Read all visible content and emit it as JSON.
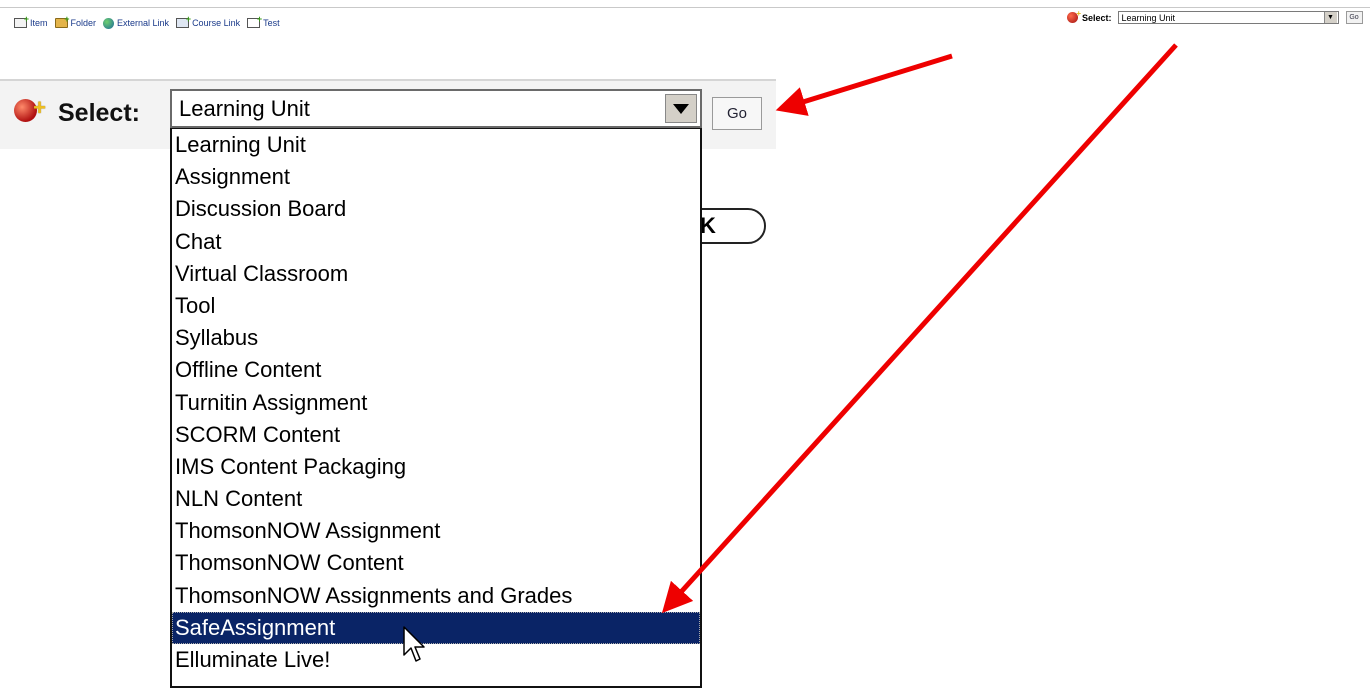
{
  "toolbar": {
    "items": [
      {
        "label": "Item",
        "icon": "add-item-icon"
      },
      {
        "label": "Folder",
        "icon": "add-folder-icon"
      },
      {
        "label": "External Link",
        "icon": "globe-icon"
      },
      {
        "label": "Course Link",
        "icon": "add-course-link-icon"
      },
      {
        "label": "Test",
        "icon": "add-test-icon"
      }
    ]
  },
  "small_select": {
    "label": "Select:",
    "value": "Learning Unit",
    "go_label": "Go"
  },
  "big_select": {
    "label": "Select:",
    "value": "Learning Unit",
    "go_label": "Go",
    "options": [
      "Learning Unit",
      "Assignment",
      "Discussion Board",
      "Chat",
      "Virtual Classroom",
      "Tool",
      "Syllabus",
      "Offline Content",
      "Turnitin Assignment",
      "SCORM Content",
      "IMS Content Packaging",
      "NLN Content",
      "ThomsonNOW Assignment",
      "ThomsonNOW Content",
      "ThomsonNOW Assignments and Grades",
      "SafeAssignment",
      "Elluminate Live!"
    ],
    "highlighted_option": "SafeAssignment"
  },
  "behind_button": {
    "label": "K"
  },
  "colors": {
    "arrow": "#ee0000",
    "selection": "#0a2466"
  }
}
